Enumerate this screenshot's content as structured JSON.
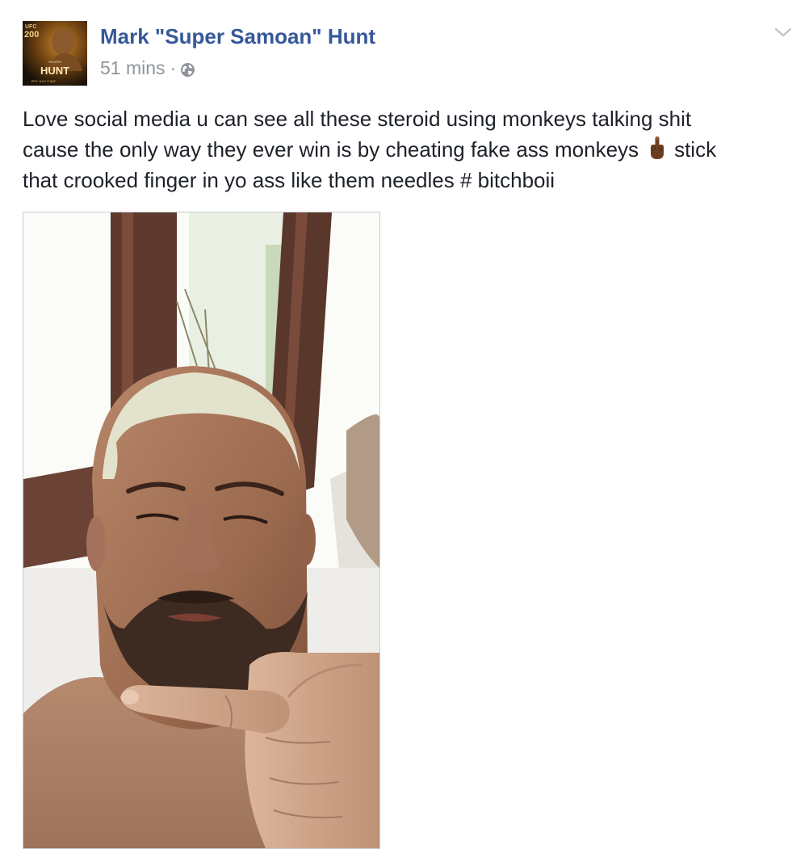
{
  "post": {
    "author": {
      "name": "Mark \"Super Samoan\" Hunt",
      "avatar_icon": "profile-photo",
      "avatar_text": {
        "brand": "UFC",
        "event": "200",
        "tagline": "I'M WITH",
        "name": "HUNT",
        "footer": "PPV JULY 9 SAT"
      }
    },
    "meta": {
      "timestamp": "51 mins",
      "separator": "·",
      "audience_icon": "globe-icon"
    },
    "menu_icon": "chevron-down-icon",
    "text": {
      "line1": "Love social media u can see all these steroid using monkeys talking shit",
      "line2_before_emoji": "cause the only way they ever win is by cheating fake ass monkeys",
      "emoji": "middle-finger-emoji",
      "line2_after_emoji": "stick",
      "line3": "that crooked finger in yo ass like them needles # bitchboii"
    },
    "photo_icon": "post-photo"
  },
  "colors": {
    "author_link": "#365899",
    "meta_text": "#90949c",
    "body_text": "#1d2129",
    "photo_border": "#c9ccd1"
  }
}
